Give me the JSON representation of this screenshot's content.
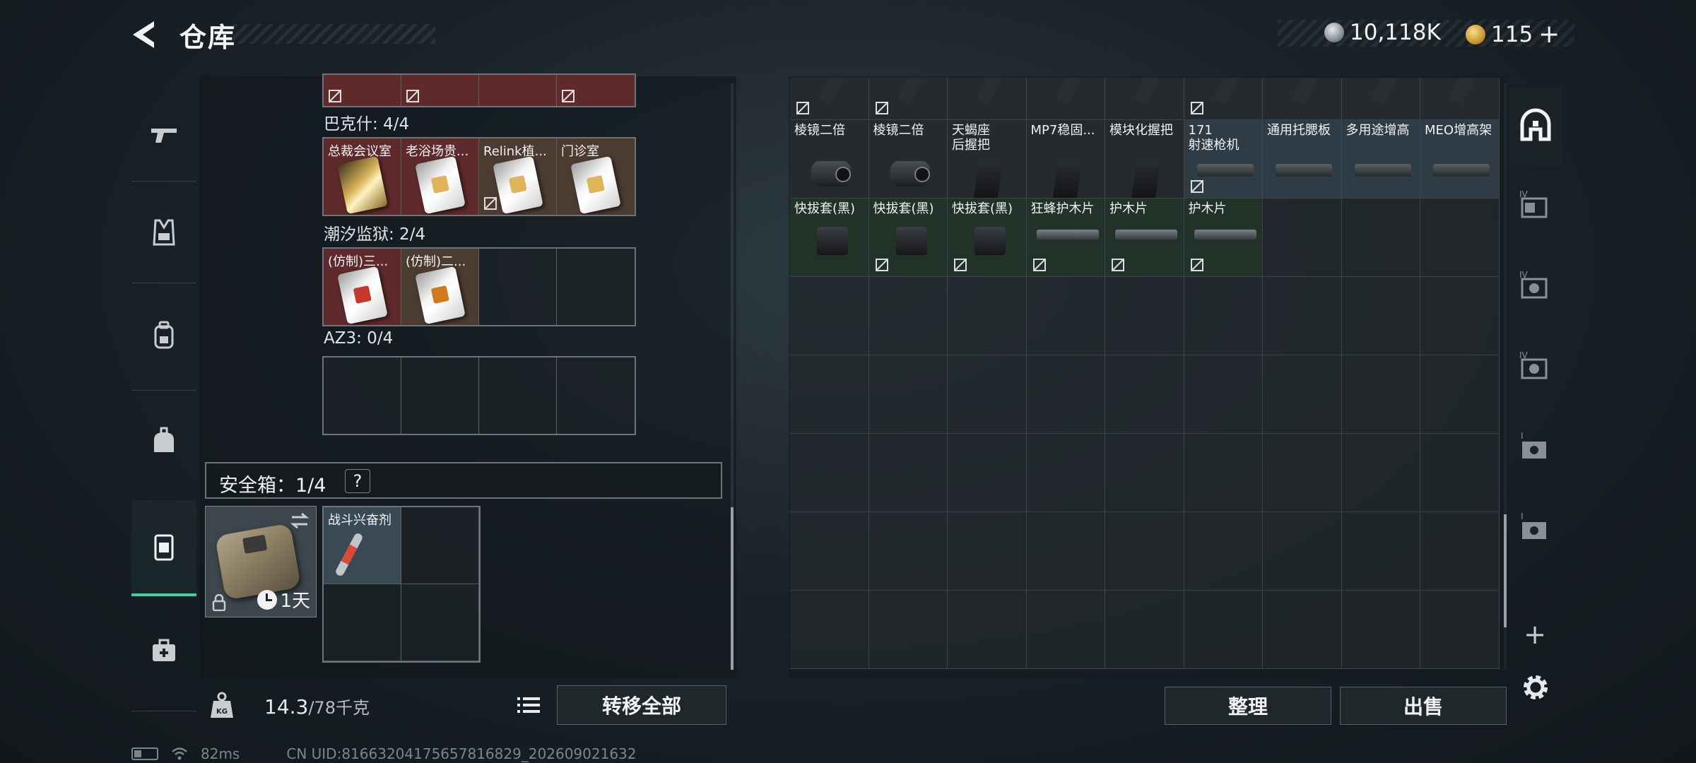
{
  "header": {
    "title": "仓库",
    "currency_silver": "10,118K",
    "currency_gold": "115",
    "gold_add_icon": "+"
  },
  "left_rail": {
    "items": [
      {
        "icon": "gun-icon"
      },
      {
        "icon": "vest-icon"
      },
      {
        "icon": "backpack-icon"
      },
      {
        "icon": "bag-icon"
      },
      {
        "icon": "safebox-tab-icon"
      },
      {
        "icon": "medkit-icon"
      }
    ]
  },
  "collections": [
    {
      "label": "巴克什: 4/4",
      "items": [
        "总裁会议室",
        "老浴场贵...",
        "Relink植...",
        "门诊室"
      ]
    },
    {
      "label": "潮汐监狱: 2/4",
      "items": [
        "(仿制)三...",
        "(仿制)二...",
        "",
        ""
      ]
    },
    {
      "label": "AZ3: 0/4",
      "items": [
        "",
        "",
        "",
        ""
      ]
    }
  ],
  "safebox": {
    "label": "安全箱：1/4",
    "help": "?",
    "timer": "1天",
    "item_name": "战斗兴奋剂"
  },
  "bottom_left": {
    "weight_current": "14.3",
    "weight_max": "/78千克",
    "transfer_all": "转移全部",
    "weight_icon_label": "KG"
  },
  "stash": {
    "row1": [
      "棱镜二倍",
      "棱镜二倍",
      "天蝎座\n后握把",
      "MP7稳固...",
      "模块化握把",
      "171\n射速枪机",
      "通用托腮板",
      "多用途增高",
      "MEO增高架"
    ],
    "row2": [
      "快拔套(黑)",
      "快拔套(黑)",
      "快拔套(黑)",
      "狂蜂护木片",
      "护木片",
      "护木片"
    ]
  },
  "bottom_right": {
    "arrange": "整理",
    "sell": "出售"
  },
  "right_rail": {
    "add": "+"
  },
  "status_bar": {
    "ping": "82ms",
    "uid": "CN UID:8166320417565781682​9_202609021632"
  }
}
